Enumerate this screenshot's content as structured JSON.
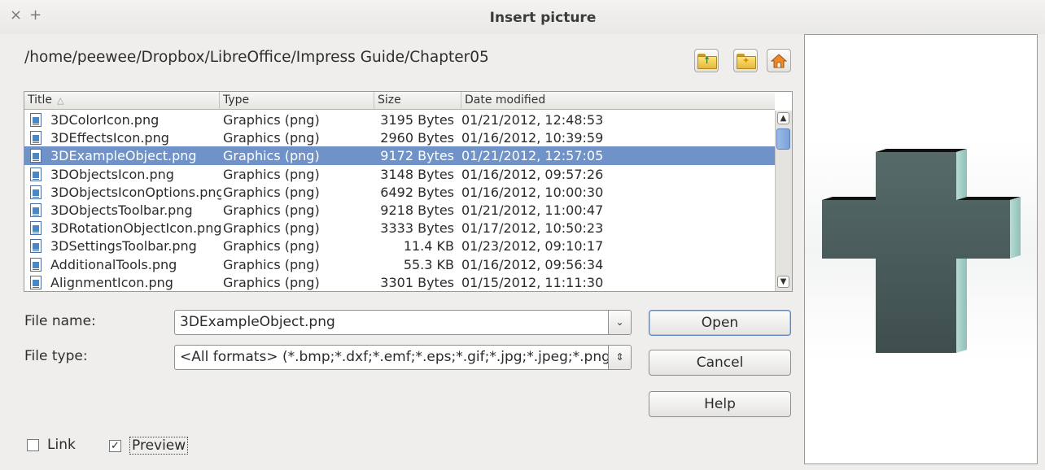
{
  "window": {
    "title": "Insert picture",
    "close_glyph": "×",
    "maximize_glyph": "+"
  },
  "path": "/home/peewee/Dropbox/LibreOffice/Impress Guide/Chapter05",
  "toolbar": {
    "up_icon": "folder-up-icon",
    "new_folder_icon": "new-folder-icon",
    "home_icon": "home-icon"
  },
  "columns": {
    "title": "Title",
    "type": "Type",
    "size": "Size",
    "date": "Date modified"
  },
  "files": [
    {
      "name": "3DColorIcon.png",
      "type": "Graphics (png)",
      "size": "3195 Bytes",
      "date": "01/21/2012, 12:48:53"
    },
    {
      "name": "3DEffectsIcon.png",
      "type": "Graphics (png)",
      "size": "2960 Bytes",
      "date": "01/16/2012, 10:39:59"
    },
    {
      "name": "3DExampleObject.png",
      "type": "Graphics (png)",
      "size": "9172 Bytes",
      "date": "01/21/2012, 12:57:05",
      "selected": true
    },
    {
      "name": "3DObjectsIcon.png",
      "type": "Graphics (png)",
      "size": "3148 Bytes",
      "date": "01/16/2012, 09:57:26"
    },
    {
      "name": "3DObjectsIconOptions.png",
      "type": "Graphics (png)",
      "size": "6492 Bytes",
      "date": "01/16/2012, 10:00:30"
    },
    {
      "name": "3DObjectsToolbar.png",
      "type": "Graphics (png)",
      "size": "9218 Bytes",
      "date": "01/21/2012, 11:00:47"
    },
    {
      "name": "3DRotationObjectIcon.png",
      "type": "Graphics (png)",
      "size": "3333 Bytes",
      "date": "01/17/2012, 10:50:23"
    },
    {
      "name": "3DSettingsToolbar.png",
      "type": "Graphics (png)",
      "size": "11.4 KB",
      "date": "01/23/2012, 09:10:17"
    },
    {
      "name": "AdditionalTools.png",
      "type": "Graphics (png)",
      "size": "55.3 KB",
      "date": "01/16/2012, 09:56:34"
    },
    {
      "name": "AlignmentIcon.png",
      "type": "Graphics (png)",
      "size": "3301 Bytes",
      "date": "01/15/2012, 11:11:30"
    }
  ],
  "form": {
    "file_name_label": "File name:",
    "file_name_value": "3DExampleObject.png",
    "file_type_label": "File type:",
    "file_type_value": "<All formats> (*.bmp;*.dxf;*.emf;*.eps;*.gif;*.jpg;*.jpeg;*.png;*.svg)"
  },
  "buttons": {
    "open": "Open",
    "cancel": "Cancel",
    "help": "Help"
  },
  "options": {
    "link_label": "Link",
    "link_checked": false,
    "preview_label": "Preview",
    "preview_checked": true
  },
  "colors": {
    "selection": "#6f92c9",
    "preview_object_face": "#4b5c5b",
    "preview_object_side": "#a9d0c9"
  }
}
